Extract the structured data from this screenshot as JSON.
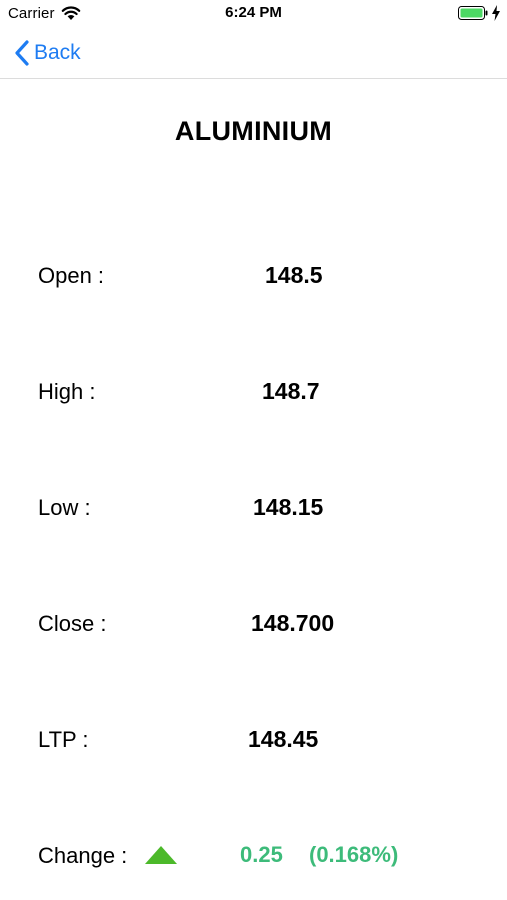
{
  "status_bar": {
    "carrier": "Carrier",
    "time": "6:24 PM"
  },
  "nav": {
    "back_label": "Back"
  },
  "title": "ALUMINIUM",
  "rows": {
    "open": {
      "label": "Open  :",
      "value": "148.5"
    },
    "high": {
      "label": "High  :",
      "value": "148.7"
    },
    "low": {
      "label": "Low  :",
      "value": "148.15"
    },
    "close": {
      "label": "Close  :",
      "value": "148.700"
    },
    "ltp": {
      "label": "LTP  :",
      "value": "148.45"
    },
    "change": {
      "label": "Change  :",
      "value": "0.25",
      "percent": "(0.168%)"
    }
  },
  "colors": {
    "accent": "#1e7cf2",
    "positive": "#3dbb7a",
    "arrow": "#4cb92a",
    "battery": "#4cd964"
  },
  "icons": {
    "status": [
      "wifi-icon",
      "battery-icon",
      "charging-bolt-icon"
    ],
    "back": "chevron-left-icon",
    "change_direction": "triangle-up-icon"
  }
}
